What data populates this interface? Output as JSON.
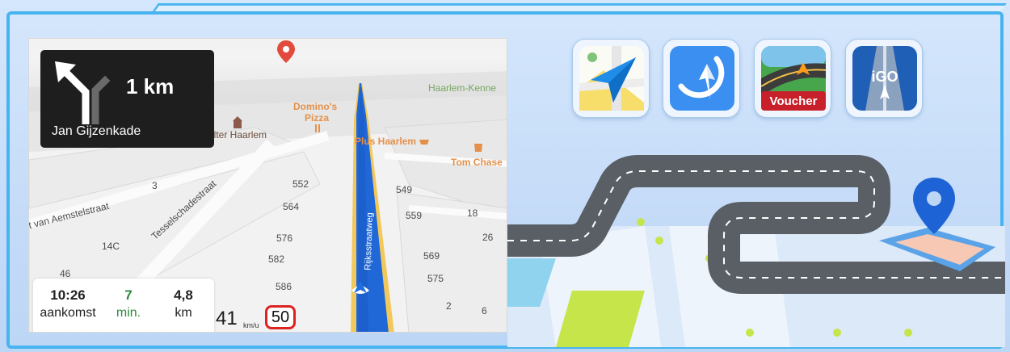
{
  "navigation": {
    "turn_distance": "1 km",
    "turn_street": "Jan Gijzenkade",
    "arrival_time": "10:26",
    "arrival_label": "aankomst",
    "remaining_minutes": "7",
    "minutes_label": "min.",
    "remaining_distance": "4,8",
    "distance_label": "km",
    "current_speed": "41",
    "speed_unit": "km/u",
    "speed_limit": "50"
  },
  "map_labels": {
    "road_rijks": "Rijksstraatweg",
    "road_tessel": "Tesselschadestraat",
    "road_aemstel": "t van Aemstelstraat",
    "poi_domino": "Domino's",
    "poi_pizza": "Pizza",
    "poi_plus": "Plus Haarlem",
    "poi_tomchase": "Tom Chase",
    "poi_kennemer": "Haarlem-Kenne",
    "poi_kelter": "elter Haarlem",
    "house_numbers": [
      "3",
      "552",
      "564",
      "576",
      "582",
      "586",
      "549",
      "559",
      "18",
      "26",
      "569",
      "575",
      "2",
      "6",
      "14C",
      "46"
    ]
  },
  "apps": [
    {
      "name": "Yandex Maps",
      "icon": "paper-plane-map-icon"
    },
    {
      "name": "Navigator",
      "icon": "compass-icon"
    },
    {
      "name": "Sygic Voucher",
      "icon": "voucher-road-icon",
      "badge": "Voucher"
    },
    {
      "name": "iGO",
      "icon": "igo-road-icon",
      "badge": "iGO"
    }
  ],
  "colors": {
    "route_blue": "#1f6fe0",
    "frame_blue": "#48b4ef",
    "limit_red": "#dd2222",
    "road_gray": "#5a5f66"
  }
}
